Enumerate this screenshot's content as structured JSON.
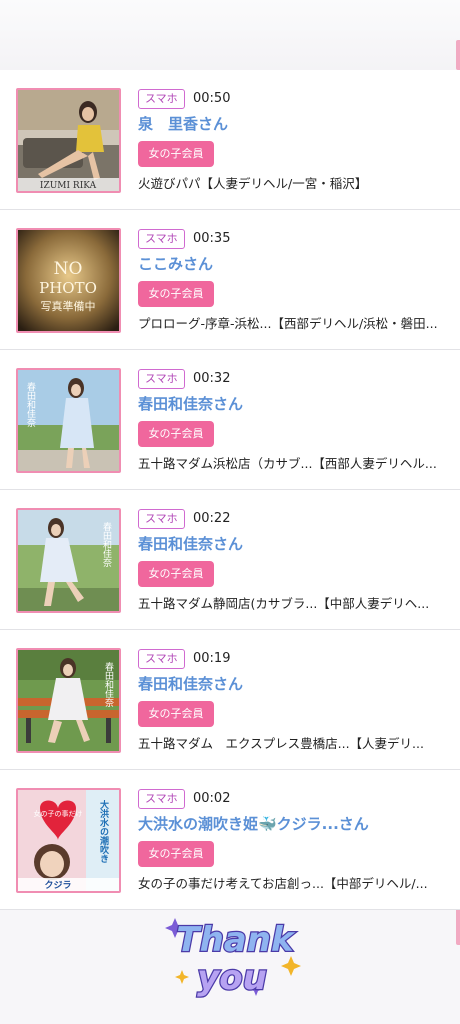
{
  "entries": [
    {
      "badge": "スマホ",
      "time": "00:50",
      "name": "泉　里香さん",
      "member_label": "女の子会員",
      "shop": "火遊びパパ【人妻デリヘル/一宮・稲沢】",
      "thumb_caption": "IZUMI RIKA"
    },
    {
      "badge": "スマホ",
      "time": "00:35",
      "name": "ここみさん",
      "member_label": "女の子会員",
      "shop": "プロローグ-序章-浜松...【西部デリヘル/浜松・磐田...",
      "thumb_caption": "NO PHOTO",
      "thumb_sub": "写真準備中"
    },
    {
      "badge": "スマホ",
      "time": "00:32",
      "name": "春田和佳奈さん",
      "member_label": "女の子会員",
      "shop": "五十路マダム浜松店（カサブ...【西部人妻デリヘル..."
    },
    {
      "badge": "スマホ",
      "time": "00:22",
      "name": "春田和佳奈さん",
      "member_label": "女の子会員",
      "shop": "五十路マダム静岡店(カサブラ...【中部人妻デリヘ..."
    },
    {
      "badge": "スマホ",
      "time": "00:19",
      "name": "春田和佳奈さん",
      "member_label": "女の子会員",
      "shop": "五十路マダム　エクスプレス豊橋店...【人妻デリ..."
    },
    {
      "badge": "スマホ",
      "time": "00:02",
      "name": "大洪水の潮吹き姫🐳クジラ...さん",
      "member_label": "女の子会員",
      "shop": "女の子の事だけ考えてお店創っ...【中部デリヘル/...",
      "thumb_caption": "クジラ"
    }
  ],
  "footer": {
    "thank_you_top": "Thank",
    "thank_you_bottom": "you"
  },
  "colors": {
    "accent_pink": "#f0679d",
    "name_blue": "#5b90d6",
    "badge_purple": "#b34ab8"
  }
}
